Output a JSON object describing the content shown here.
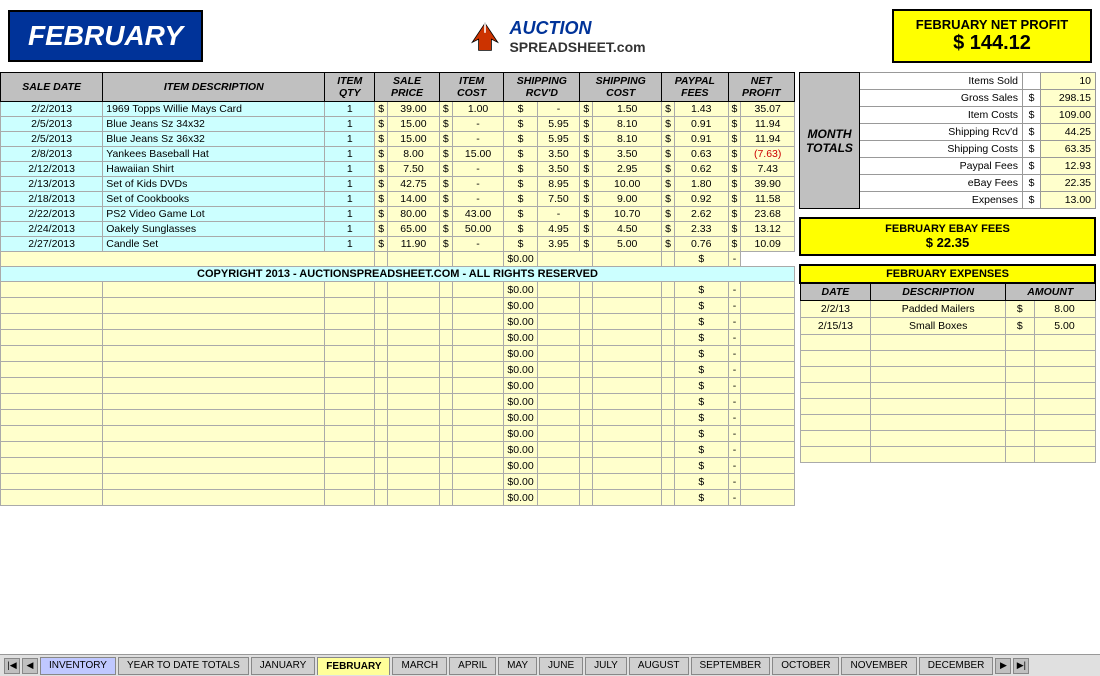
{
  "header": {
    "month": "FEBRUARY",
    "logo_line1": "AUCTION",
    "logo_line2": "SPREADSHEET.com",
    "net_profit_label": "FEBRUARY NET PROFIT",
    "net_profit_currency": "$",
    "net_profit_amount": "144.12"
  },
  "table": {
    "headers": [
      "SALE DATE",
      "ITEM DESCRIPTION",
      "ITEM QTY",
      "SALE PRICE",
      "ITEM COST",
      "SHIPPING RCV'D",
      "SHIPPING COST",
      "PAYPAL FEES",
      "NET PROFIT"
    ],
    "rows": [
      [
        "2/2/2013",
        "1969 Topps Willie Mays Card",
        "1",
        "$",
        "39.00",
        "$",
        "1.00",
        "$",
        "-",
        "$",
        "1.50",
        "$",
        "1.43",
        "$",
        "35.07"
      ],
      [
        "2/5/2013",
        "Blue Jeans Sz 34x32",
        "1",
        "$",
        "15.00",
        "$",
        "-",
        "$",
        "5.95",
        "$",
        "8.10",
        "$",
        "0.91",
        "$",
        "11.94"
      ],
      [
        "2/5/2013",
        "Blue Jeans Sz 36x32",
        "1",
        "$",
        "15.00",
        "$",
        "-",
        "$",
        "5.95",
        "$",
        "8.10",
        "$",
        "0.91",
        "$",
        "11.94"
      ],
      [
        "2/8/2013",
        "Yankees Baseball Hat",
        "1",
        "$",
        "8.00",
        "$",
        "15.00",
        "$",
        "3.50",
        "$",
        "3.50",
        "$",
        "0.63",
        "$",
        "(7.63)"
      ],
      [
        "2/12/2013",
        "Hawaiian Shirt",
        "1",
        "$",
        "7.50",
        "$",
        "-",
        "$",
        "3.50",
        "$",
        "2.95",
        "$",
        "0.62",
        "$",
        "7.43"
      ],
      [
        "2/13/2013",
        "Set of Kids DVDs",
        "1",
        "$",
        "42.75",
        "$",
        "-",
        "$",
        "8.95",
        "$",
        "10.00",
        "$",
        "1.80",
        "$",
        "39.90"
      ],
      [
        "2/18/2013",
        "Set of Cookbooks",
        "1",
        "$",
        "14.00",
        "$",
        "-",
        "$",
        "7.50",
        "$",
        "9.00",
        "$",
        "0.92",
        "$",
        "11.58"
      ],
      [
        "2/22/2013",
        "PS2 Video Game Lot",
        "1",
        "$",
        "80.00",
        "$",
        "43.00",
        "$",
        "-",
        "$",
        "10.70",
        "$",
        "2.62",
        "$",
        "23.68"
      ],
      [
        "2/24/2013",
        "Oakely Sunglasses",
        "1",
        "$",
        "65.00",
        "$",
        "50.00",
        "$",
        "4.95",
        "$",
        "4.50",
        "$",
        "2.33",
        "$",
        "13.12"
      ],
      [
        "2/27/2013",
        "Candle Set",
        "1",
        "$",
        "11.90",
        "$",
        "-",
        "$",
        "3.95",
        "$",
        "5.00",
        "$",
        "0.76",
        "$",
        "10.09"
      ]
    ],
    "total_row": [
      "",
      "",
      "",
      "",
      "",
      "",
      "",
      "$0.00",
      "$",
      "-"
    ],
    "copyright": "COPYRIGHT 2013 - AUCTIONSPREADSHEET.COM - ALL RIGHTS RESERVED"
  },
  "month_totals": {
    "label": "MONTH TOTALS",
    "items_sold_label": "Items Sold",
    "items_sold_value": "10",
    "gross_sales_label": "Gross Sales",
    "gross_sales_dollar": "$",
    "gross_sales_value": "298.15",
    "item_costs_label": "Item Costs",
    "item_costs_dollar": "$",
    "item_costs_value": "109.00",
    "shipping_rcvd_label": "Shipping Rcv'd",
    "shipping_rcvd_dollar": "$",
    "shipping_rcvd_value": "44.25",
    "shipping_costs_label": "Shipping Costs",
    "shipping_costs_dollar": "$",
    "shipping_costs_value": "63.35",
    "paypal_fees_label": "Paypal Fees",
    "paypal_fees_dollar": "$",
    "paypal_fees_value": "12.93",
    "ebay_fees_label": "eBay Fees",
    "ebay_fees_dollar": "$",
    "ebay_fees_value": "22.35",
    "expenses_label": "Expenses",
    "expenses_dollar": "$",
    "expenses_value": "13.00"
  },
  "ebay_fees_box": {
    "label": "FEBRUARY EBAY FEES",
    "dollar": "$",
    "amount": "22.35"
  },
  "expenses": {
    "header": "FEBRUARY EXPENSES",
    "col_date": "DATE",
    "col_description": "DESCRIPTION",
    "col_amount": "AMOUNT",
    "rows": [
      [
        "2/2/13",
        "Padded Mailers",
        "$",
        "8.00"
      ],
      [
        "2/15/13",
        "Small Boxes",
        "$",
        "5.00"
      ]
    ]
  },
  "tabs": [
    {
      "label": "INVENTORY",
      "active": false
    },
    {
      "label": "YEAR TO DATE TOTALS",
      "active": false
    },
    {
      "label": "JANUARY",
      "active": false
    },
    {
      "label": "FEBRUARY",
      "active": true
    },
    {
      "label": "MARCH",
      "active": false
    },
    {
      "label": "APRIL",
      "active": false
    },
    {
      "label": "MAY",
      "active": false
    },
    {
      "label": "JUNE",
      "active": false
    },
    {
      "label": "JULY",
      "active": false
    },
    {
      "label": "AUGUST",
      "active": false
    },
    {
      "label": "SEPTEMBER",
      "active": false
    },
    {
      "label": "OCTOBER",
      "active": false
    },
    {
      "label": "NOVEMBER",
      "active": false
    },
    {
      "label": "DECEMBER",
      "active": false
    }
  ]
}
